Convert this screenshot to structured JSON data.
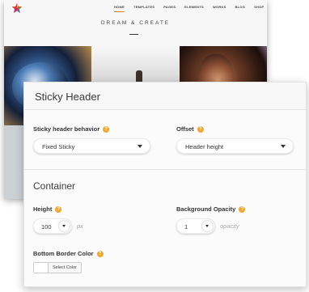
{
  "site": {
    "nav": [
      "HOME",
      "TEMPLATES",
      "PAGES",
      "ELEMENTS",
      "WORKS",
      "BLOG",
      "SHOP"
    ],
    "nav_icons": [
      "search-icon",
      "cart-icon"
    ],
    "cart_count": "0",
    "title": "DREAM & CREATE"
  },
  "panel": {
    "title": "Sticky Header",
    "behavior": {
      "label": "Sticky header behavior",
      "value": "Fixed Sticky"
    },
    "offset": {
      "label": "Offset",
      "value": "Header height"
    },
    "container_title": "Container",
    "height": {
      "label": "Height",
      "value": "100",
      "unit": "px"
    },
    "opacity": {
      "label": "Background Opacity",
      "value": "1",
      "unit": "opacity"
    },
    "border_color": {
      "label": "Bottom Border Color",
      "button": "Select Color"
    },
    "help_glyph": "?",
    "colors": {
      "accent": "#f0a830",
      "nav_active": "#e67e22"
    }
  }
}
